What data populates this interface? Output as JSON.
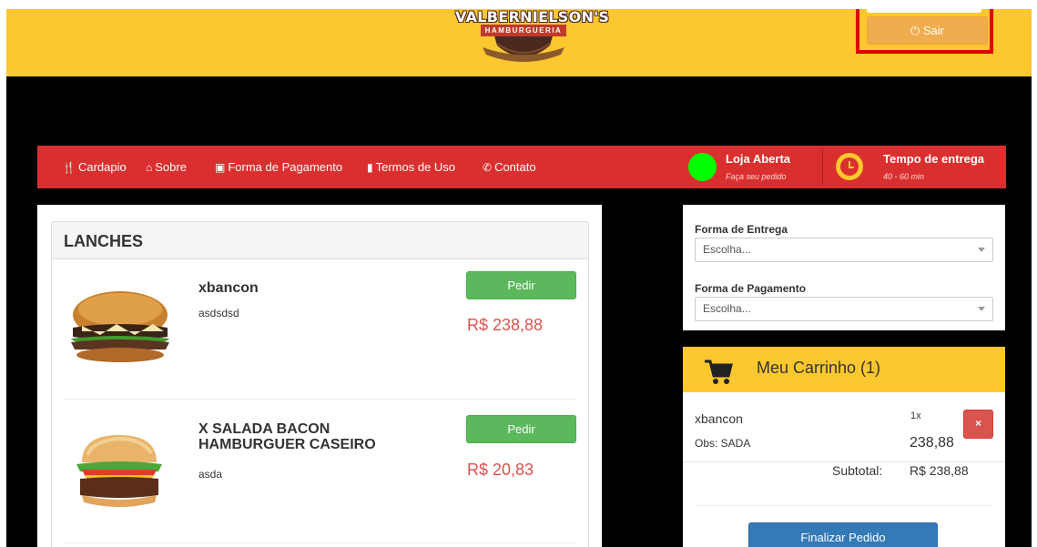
{
  "header": {
    "logo_title": "VALBERNIELSON'S",
    "logo_subtitle": "HAMBURGUERIA",
    "sair_label": "Sair",
    "sair_icon": "power-icon",
    "colors": {
      "header_bg": "#fdc72f",
      "sair_bg": "#f0ad4e",
      "highlight_border": "#e10000"
    }
  },
  "nav": {
    "items": [
      {
        "label": "Cardapio",
        "icon": "cutlery-icon"
      },
      {
        "label": "Sobre",
        "icon": "home-icon"
      },
      {
        "label": "Forma de Pagamento",
        "icon": "money-icon"
      },
      {
        "label": "Termos de Uso",
        "icon": "file-icon"
      },
      {
        "label": "Contato",
        "icon": "phone-icon"
      }
    ],
    "store_status": {
      "title": "Loja Aberta",
      "subtitle": "Faça seu pedido",
      "indicator_color": "#00ff00"
    },
    "delivery_time": {
      "title": "Tempo de entrega",
      "subtitle": "40 - 60 min"
    },
    "colors": {
      "nav_bg": "#d9302f"
    }
  },
  "menu": {
    "section_title": "LANCHES",
    "products": [
      {
        "name": "xbancon",
        "description": "asdsdsd",
        "button_label": "Pedir",
        "price": "R$ 238,88"
      },
      {
        "name": "X SALADA BACON HAMBURGUER CASEIRO",
        "description": "asda",
        "button_label": "Pedir",
        "price": "R$ 20,83"
      }
    ]
  },
  "order_form": {
    "delivery_label": "Forma de Entrega",
    "delivery_value": "Escolha...",
    "payment_label": "Forma de Pagamento",
    "payment_value": "Escolha..."
  },
  "cart": {
    "title": "Meu Carrinho (1)",
    "items": [
      {
        "name": "xbancon",
        "obs": "Obs: SADA",
        "qty": "1x",
        "price": "238,88",
        "remove_label": "×"
      }
    ],
    "subtotal_label": "Subtotal:",
    "subtotal_value": "R$ 238,88",
    "finalize_label": "Finalizar Pedido"
  }
}
